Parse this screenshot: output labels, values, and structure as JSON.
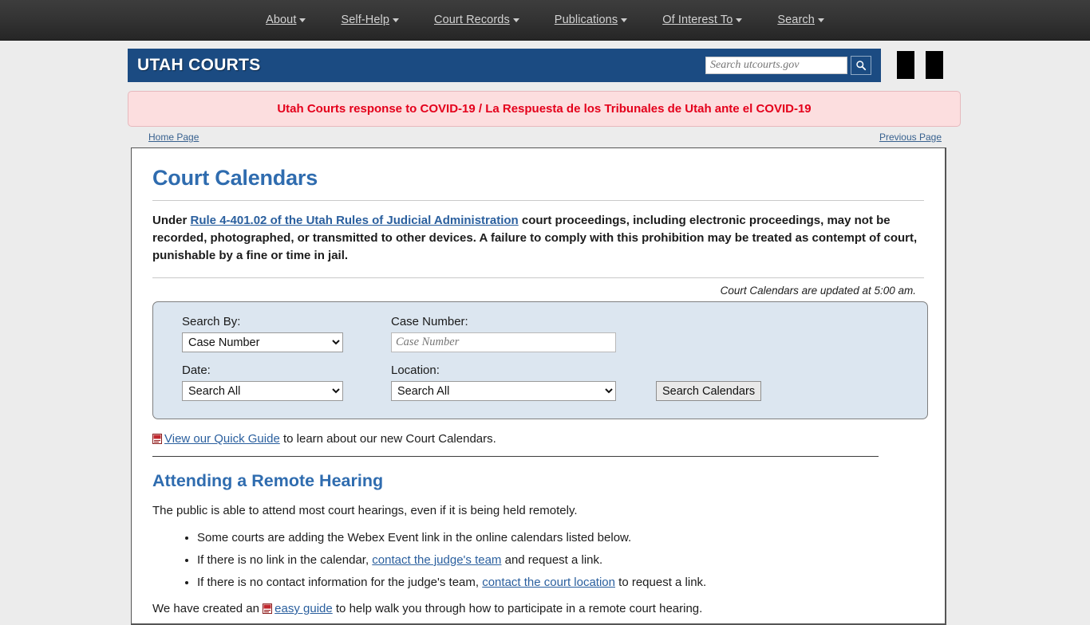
{
  "topnav": {
    "items": [
      {
        "label": "About",
        "has_caret": true
      },
      {
        "label": "Self-Help",
        "has_caret": true
      },
      {
        "label": "Court Records",
        "has_caret": true
      },
      {
        "label": "Publications",
        "has_caret": true
      },
      {
        "label": "Of Interest To",
        "has_caret": true
      },
      {
        "label": "Search",
        "has_caret": true
      }
    ]
  },
  "header": {
    "logo_text": "UTAH COURTS",
    "brand_color": "#1b4b82",
    "search_placeholder": "Search utcourts.gov",
    "search_value": "",
    "search_button_icon": "search-icon"
  },
  "banner": {
    "text": "Utah Courts response to COVID-19 / La Respuesta de los Tribunales de Utah ante el COVID-19",
    "text_color": "#e4001b",
    "background_color": "#fcdedf"
  },
  "breadcrumb": {
    "home_label": "Home Page",
    "previous_label": "Previous Page"
  },
  "main": {
    "title": "Court Calendars",
    "title_color": "#2f6caf",
    "intro": {
      "before_link": "Under ",
      "link_text": "Rule 4-401.02 of the Utah Rules of Judicial Administration",
      "after_link": " court proceedings, including electronic proceedings, may not be recorded, photographed, or transmitted to other devices. A failure to comply with this prohibition may be treated as contempt of court, punishable by a fine or time in jail."
    },
    "updated_note": "Court Calendars are updated at 5:00 am.",
    "form": {
      "search_by_label": "Search By:",
      "search_by_value": "Case Number",
      "search_by_options": [
        "Case Number"
      ],
      "case_number_label": "Case Number:",
      "case_number_placeholder": "Case Number",
      "case_number_value": "",
      "date_label": "Date:",
      "date_value": "Search All",
      "date_options": [
        "Search All"
      ],
      "location_label": "Location:",
      "location_value": "Search All",
      "location_options": [
        "Search All"
      ],
      "submit_label": "Search Calendars"
    },
    "quick_guide": {
      "icon": "pdf-icon",
      "link_text": "View our Quick Guide",
      "after_text": " to learn about our new Court Calendars."
    },
    "remote": {
      "heading": "Attending a Remote Hearing",
      "paragraph": "The public is able to attend most court hearings, even if it is being held remotely.",
      "bullets": [
        {
          "before": "Some courts are adding the Webex Event link in the online calendars listed below.",
          "link": "",
          "after": ""
        },
        {
          "before": "If there is no link in the calendar, ",
          "link": "contact the judge's team",
          "after": " and request a link."
        },
        {
          "before": "If there is no contact information for the judge's team, ",
          "link": "contact the court location",
          "after": " to request a link."
        }
      ],
      "closing_before": "We have created an ",
      "closing_icon": "pdf-icon",
      "closing_link": "easy guide",
      "closing_after": " to help walk you through how to participate in a remote court hearing."
    }
  }
}
